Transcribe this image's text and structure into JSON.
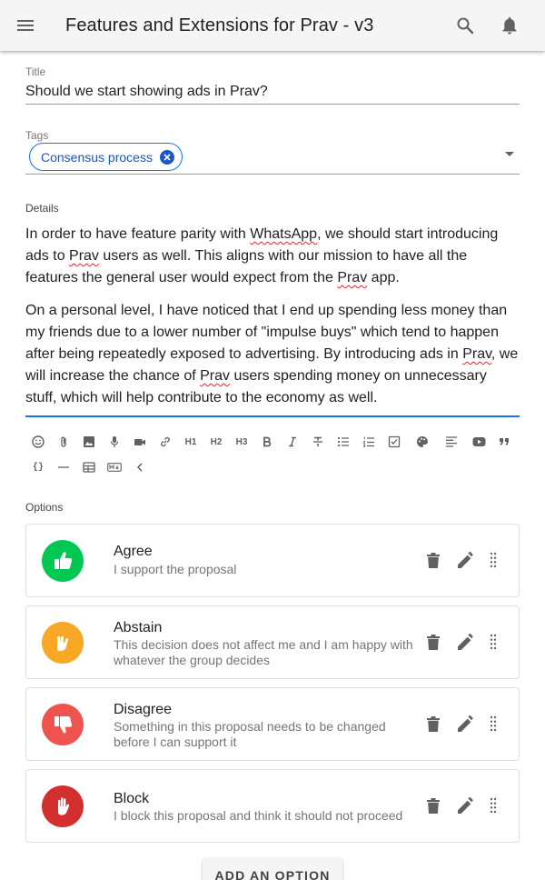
{
  "header": {
    "title": "Features and Extensions for Prav - v3"
  },
  "form": {
    "title_label": "Title",
    "title_value": "Should we start showing ads in Prav?",
    "tags_label": "Tags",
    "tags": [
      "Consensus process"
    ],
    "details_label": "Details",
    "details_p1": [
      "In order to have feature parity with ",
      "WhatsApp",
      ", we should start introducing ads to ",
      "Prav",
      " users as well. This aligns with our mission to have all the features the general user would expect from the ",
      "Prav",
      " app."
    ],
    "details_p2": [
      "On a personal level, I have noticed that I end up spending less money than my friends due to a lower number of \"impulse buys\" which tend to happen after being repeatedly exposed to advertising. By introducing ads in ",
      "Prav",
      ", we will increase the chance of ",
      "Prav",
      " users spending money on unnecessary stuff, which will help contribute to the economy as well."
    ],
    "toolbar_text": {
      "h1": "H1",
      "h2": "H2",
      "h3": "H3",
      "code": "{}"
    }
  },
  "options_label": "Options",
  "options": [
    {
      "name": "Agree",
      "description": "I support the proposal",
      "color": "#00c853",
      "icon": "thumbs-up-icon"
    },
    {
      "name": "Abstain",
      "description": "This decision does not affect me and I am happy with whatever the group decides",
      "color": "#f9a825",
      "icon": "hand-abstain-icon"
    },
    {
      "name": "Disagree",
      "description": "Something in this proposal needs to be changed before I can support it",
      "color": "#ef5350",
      "icon": "thumbs-down-icon"
    },
    {
      "name": "Block",
      "description": "I block this proposal and think it should not proceed",
      "color": "#d32f2f",
      "icon": "hand-stop-icon"
    }
  ],
  "add_option_label": "ADD AN OPTION",
  "colors": {
    "accent": "#1a73e8",
    "appbar": "#f5f5f5"
  }
}
